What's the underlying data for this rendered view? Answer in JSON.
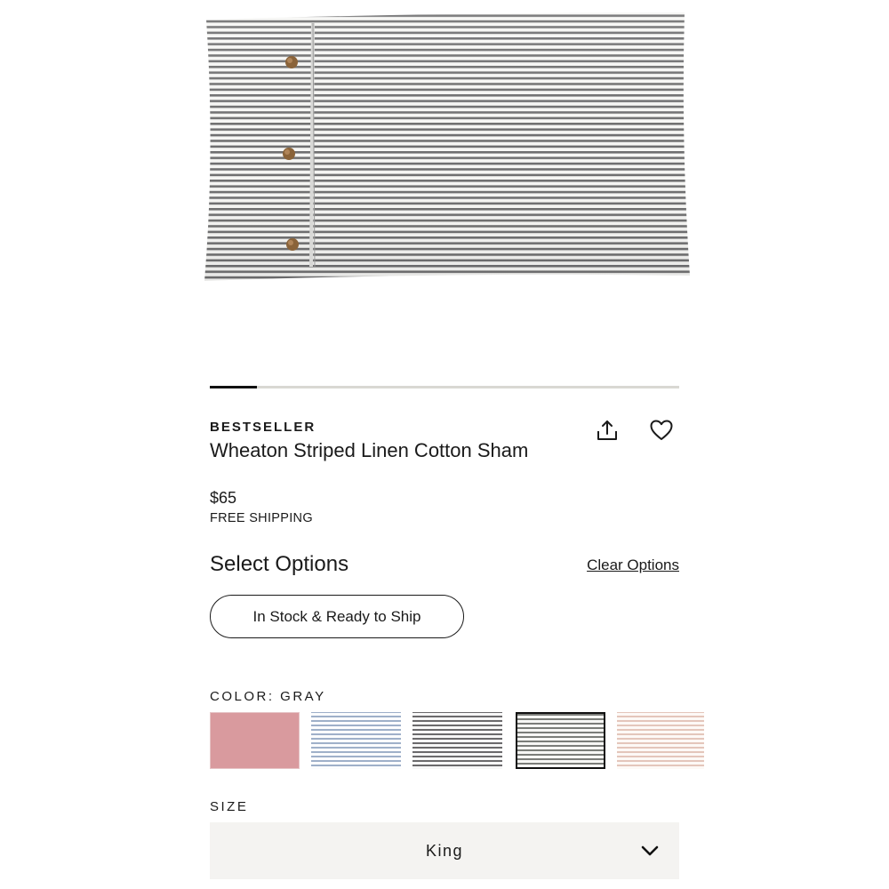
{
  "product": {
    "badge": "BESTSELLER",
    "title": "Wheaton Striped Linen Cotton Sham",
    "price": "$65",
    "shipping": "FREE SHIPPING",
    "image_icon": "striped-pillow-sham-image",
    "carousel_progress": 0.1
  },
  "actions": {
    "share_icon": "share-icon",
    "wishlist_icon": "heart-icon"
  },
  "options": {
    "heading": "Select Options",
    "clear_label": "Clear Options",
    "stock_filter_label": "In Stock & Ready to Ship"
  },
  "color": {
    "label": "COLOR: GRAY",
    "swatches": [
      {
        "name": "pink",
        "color": "#d99a9e"
      },
      {
        "name": "blue-stripe",
        "color": "#9fb0c9"
      },
      {
        "name": "charcoal-stripe",
        "color": "#6b6a6c"
      },
      {
        "name": "gray-stripe",
        "color": "#7b7d79",
        "selected": true
      },
      {
        "name": "sand-stripe",
        "color": "#e4c6bb"
      }
    ]
  },
  "size": {
    "label": "SIZE",
    "selected": "King",
    "icon": "chevron-down-icon"
  }
}
